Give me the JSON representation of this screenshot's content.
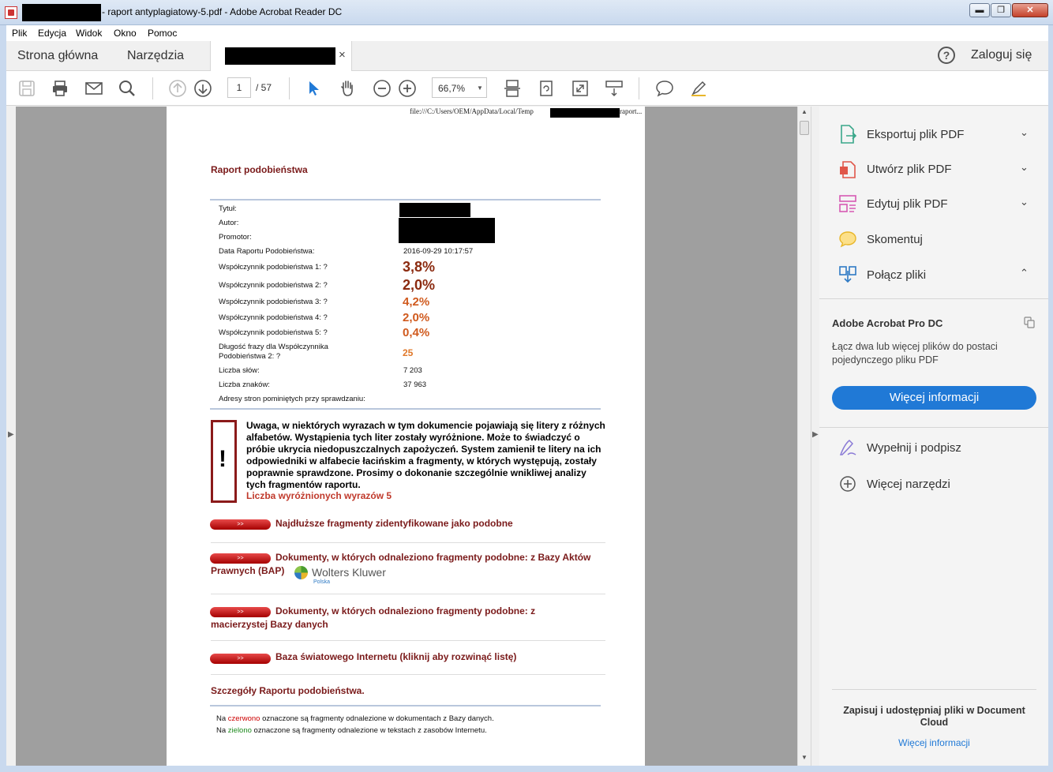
{
  "window": {
    "title": "- raport antyplagiatowy-5.pdf - Adobe Acrobat Reader DC",
    "min": "▬",
    "max": "❐",
    "close": "✕"
  },
  "menu": [
    "Plik",
    "Edycja",
    "Widok",
    "Okno",
    "Pomoc"
  ],
  "tabs": {
    "home": "Strona główna",
    "tools": "Narzędzia",
    "doc_close": "×",
    "help": "?",
    "login": "Zaloguj się"
  },
  "toolbar": {
    "page_current": "1",
    "page_total": "/ 57",
    "zoom": "66,7%",
    "zoom_arrow": "▼"
  },
  "document": {
    "path_prefix": "file:///C:/Users/OEM/AppData/Local/Temp",
    "path_suffix": "raport...",
    "title": "Raport podobieństwa",
    "fields": [
      {
        "label": "Tytuł:",
        "value": ""
      },
      {
        "label": "Autor:",
        "value": ""
      },
      {
        "label": "Promotor:",
        "value": ""
      },
      {
        "label": "Data Raportu Podobieństwa:",
        "value": "2016-09-29 10:17:57"
      }
    ],
    "coefficients": [
      {
        "label": "Współczynnik podobieństwa 1:   ?",
        "value": "3,8%",
        "color": "#8b2a0f"
      },
      {
        "label": "Współczynnik podobieństwa 2:   ?",
        "value": "2,0%",
        "color": "#8b2a0f"
      },
      {
        "label": "Współczynnik podobieństwa 3:   ?",
        "value": "4,2%",
        "color": "#d05a1e"
      },
      {
        "label": "Współczynnik podobieństwa 4:   ?",
        "value": "2,0%",
        "color": "#d05a1e"
      },
      {
        "label": "Współczynnik podobieństwa 5:   ?",
        "value": "0,4%",
        "color": "#d05a1e"
      }
    ],
    "phrase_label_1": "Długość frazy dla Współczynnika",
    "phrase_label_2": "Podobieństwa 2:   ?",
    "phrase_value": "25",
    "words_label": "Liczba słów:",
    "words_value": "7 203",
    "chars_label": "Liczba znaków:",
    "chars_value": "37 963",
    "skipped_label": "Adresy stron pominiętych przy sprawdzaniu:",
    "warning_mark": "!",
    "warning_text": "Uwaga, w niektórych wyrazach w tym dokumencie pojawiają się litery z różnych alfabetów. Wystąpienia tych liter zostały wyróżnione. Może to świadczyć o próbie ukrycia niedopuszczalnych zapożyczeń. System zamienił te litery na ich odpowiedniki w alfabecie łacińskim a fragmenty, w których występują, zostały poprawnie sprawdzone. Prosimy o dokonanie szczególnie wnikliwej analizy tych fragmentów raportu.",
    "warning_count": "Liczba wyróżnionych wyrazów 5",
    "pill_label": ">>",
    "section_longest": "Najdłuższe fragmenty zidentyfikowane jako podobne",
    "section_bap": "Dokumenty, w których odnaleziono fragmenty podobne: z Bazy Aktów Prawnych (BAP)",
    "wk_name": "Wolters Kluwer",
    "wk_sub": "Polska",
    "section_mother": "Dokumenty, w których odnaleziono fragmenty podobne: z macierzystej Bazy danych",
    "section_internet": "Baza światowego Internetu (kliknij aby rozwinąć listę)",
    "details_title": "Szczegóły Raportu podobieństwa.",
    "legend_red_pre": "Na ",
    "legend_red_word": "czerwono",
    "legend_red_post": " oznaczone są fragmenty odnalezione w dokumentach z Bazy danych.",
    "legend_green_pre": "Na ",
    "legend_green_word": "zielono",
    "legend_green_post": " oznaczone są fragmenty odnalezione w tekstach z zasobów Internetu."
  },
  "right_panel": {
    "items": [
      {
        "label": "Eksportuj plik PDF",
        "chev": "⌄"
      },
      {
        "label": "Utwórz plik PDF",
        "chev": "⌄"
      },
      {
        "label": "Edytuj plik PDF",
        "chev": "⌄"
      },
      {
        "label": "Skomentuj",
        "chev": ""
      },
      {
        "label": "Połącz pliki",
        "chev": "⌃"
      }
    ],
    "promo_title": "Adobe Acrobat Pro DC",
    "promo_text": "Łącz dwa lub więcej plików do postaci pojedynczego pliku PDF",
    "promo_button": "Więcej informacji",
    "tool_fill": "Wypełnij i podpisz",
    "tool_more": "Więcej narzędzi",
    "cloud_text": "Zapisuj i udostępniaj pliki w Document Cloud",
    "cloud_link": "Więcej informacji"
  }
}
